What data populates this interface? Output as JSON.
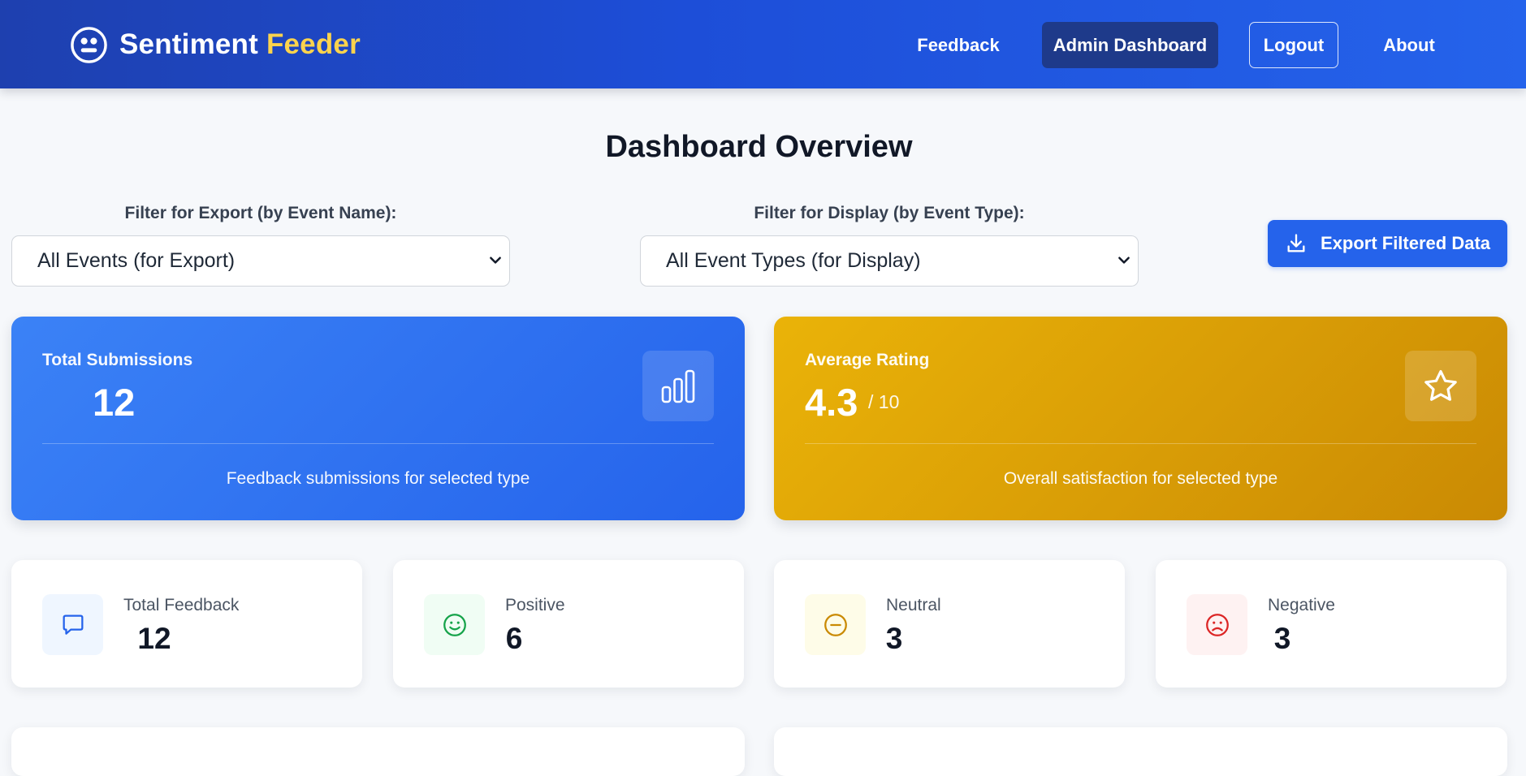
{
  "brand": {
    "name_primary": "Sentiment",
    "name_accent": "Feeder",
    "icon": "robot-face-icon",
    "accent_color": "#fcd34d"
  },
  "nav": {
    "items": [
      {
        "label": "Feedback",
        "active": false
      },
      {
        "label": "Admin Dashboard",
        "active": true
      },
      {
        "label": "Logout",
        "active": false,
        "outlined": true
      },
      {
        "label": "About",
        "active": false
      }
    ]
  },
  "page": {
    "title": "Dashboard Overview"
  },
  "filters": {
    "export": {
      "label": "Filter for Export (by Event Name):",
      "selected": "All Events (for Export)"
    },
    "display": {
      "label": "Filter for Display (by Event Type):",
      "selected": "All Event Types (for Display)"
    },
    "export_button": {
      "label": "Export Filtered Data",
      "icon": "download-icon"
    }
  },
  "summary_cards": [
    {
      "label": "Total Submissions",
      "value": "12",
      "caption": "Feedback submissions for selected type",
      "icon": "bar-chart-icon",
      "color": "#2563eb"
    },
    {
      "label": "Average Rating",
      "value": "4.3",
      "suffix": "/ 10",
      "caption": "Overall satisfaction for selected type",
      "icon": "star-icon",
      "color": "#ca8a04"
    }
  ],
  "stat_cards": [
    {
      "label": "Total Feedback",
      "value": "12",
      "icon": "chat-bubble-icon",
      "color": "#2563eb"
    },
    {
      "label": "Positive",
      "value": "6",
      "icon": "smile-icon",
      "color": "#16a34a"
    },
    {
      "label": "Neutral",
      "value": "3",
      "icon": "neutral-face-icon",
      "color": "#ca8a04"
    },
    {
      "label": "Negative",
      "value": "3",
      "icon": "frown-icon",
      "color": "#dc2626"
    }
  ]
}
